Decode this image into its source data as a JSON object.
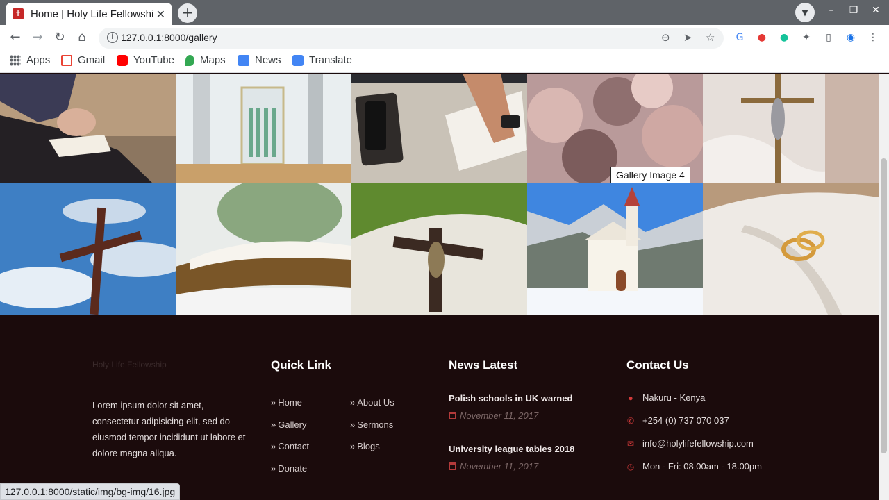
{
  "browser": {
    "tab_title": "Home | Holy Life Fellowship",
    "url": "127.0.0.1:8000/gallery",
    "bookmarks": [
      "Apps",
      "Gmail",
      "YouTube",
      "Maps",
      "News",
      "Translate"
    ],
    "status_url": "127.0.0.1:8000/static/img/bg-img/16.jpg",
    "icons": {
      "back": "←",
      "forward": "→",
      "reload": "↻",
      "home": "⌂",
      "zoom": "⊖",
      "send": "➤",
      "star": "☆",
      "new_tab": "+",
      "close": "✕",
      "minimize": "–",
      "restore": "❐",
      "menu": "⋮"
    }
  },
  "gallery": {
    "tooltip": "Gallery Image 4",
    "images": [
      {
        "name": "woman-praying-bible"
      },
      {
        "name": "church-interior-organ"
      },
      {
        "name": "hands-reading-bible"
      },
      {
        "name": "blurred-congregation"
      },
      {
        "name": "crucifix-on-fabric"
      },
      {
        "name": "wooden-cross-sky"
      },
      {
        "name": "open-bible-closeup"
      },
      {
        "name": "crucifix-on-book"
      },
      {
        "name": "snowy-mountain-church"
      },
      {
        "name": "rings-on-bible"
      }
    ]
  },
  "footer": {
    "logo_alt": "Holy Life Fellowship",
    "about_text": "Lorem ipsum dolor sit amet, consectetur adipisicing elit, sed do eiusmod tempor incididunt ut labore et dolore magna aliqua.",
    "quick_link_heading": "Quick Link",
    "quick_links_left": [
      "Home",
      "Gallery",
      "Contact",
      "Donate"
    ],
    "quick_links_right": [
      "About Us",
      "Sermons",
      "Blogs"
    ],
    "news_heading": "News Latest",
    "news": [
      {
        "title": "Polish schools in UK warned",
        "date": "November 11, 2017"
      },
      {
        "title": "University league tables 2018",
        "date": "November 11, 2017"
      }
    ],
    "contact_heading": "Contact Us",
    "contact": {
      "location": "Nakuru - Kenya",
      "phone": "+254 (0) 737 070 037",
      "email": "info@holylifefellowship.com",
      "hours": "Mon - Fri: 08.00am - 18.00pm"
    }
  },
  "colors": {
    "footer_bg": "#1b0b0c",
    "accent": "#d33a3a"
  }
}
